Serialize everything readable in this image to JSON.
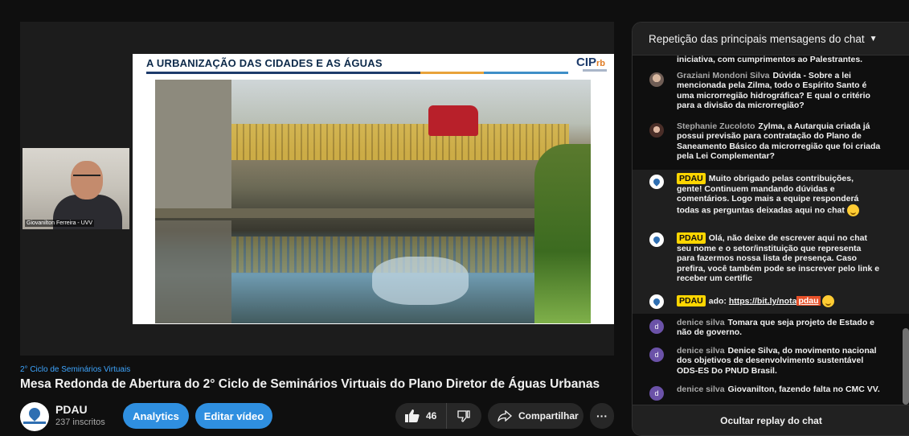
{
  "video": {
    "slide": {
      "title": "A URBANIZAÇÃO DAS CIDADES E AS ÁGUAS",
      "logo_main": "CIP",
      "logo_accent": "rb"
    },
    "camera_label": "Giovanilton Ferreira - UVV"
  },
  "meta": {
    "playlist": "2° Ciclo de Seminários Virtuais",
    "title": "Mesa Redonda de Abertura do 2° Ciclo de Seminários Virtuais do Plano Diretor de Águas Urbanas",
    "channel": "PDAU",
    "subscribers": "237 inscritos",
    "analytics_label": "Analytics",
    "edit_label": "Editar vídeo",
    "likes": "46",
    "share_label": "Compartilhar",
    "more_label": "···"
  },
  "chat": {
    "header": "Repetição das principais mensagens do chat",
    "footer": "Ocultar replay do chat",
    "messages": [
      {
        "name": "",
        "text": "iniciativa, com cumprimentos ao Palestrantes."
      },
      {
        "name": "Graziani Mondoni Silva",
        "text": "Dúvida - Sobre a lei mencionada pela Zilma, todo o Espírito Santo é uma microrregião hidrográfica? E qual o critério para a divisão da microrregião?"
      },
      {
        "name": "Stephanie Zucoloto",
        "text": "Zylma, a Autarquia criada já possui previsão para contratação do Plano de Saneamento Básico da microrregião que foi criada pela Lei Complementar?"
      },
      {
        "name": "PDAU",
        "text": "Muito obrigado pelas contribuições, gente! Continuem mandando dúvidas e comentários. Logo mais a equipe responderá todas as perguntas deixadas aqui no chat"
      },
      {
        "name": "PDAU",
        "text": "Olá, não deixe de escrever aqui no chat seu nome e o setor/instituição que representa para fazermos nossa lista de presença. Caso prefira, você também pode se inscrever pelo link e receber um certific"
      },
      {
        "name": "PDAU",
        "text_pre": "ado: ",
        "link": "https://bit.ly/nota",
        "link_hl": "pdau"
      },
      {
        "name": "denice silva",
        "text": "Tomara que seja projeto de Estado e não de governo.",
        "initial": "d"
      },
      {
        "name": "denice silva",
        "text": "Denice Silva, do movimento nacional dos objetivos de desenvolvimento sustentável ODS-ES Do PNUD Brasil.",
        "initial": "d"
      },
      {
        "name": "denice silva",
        "text": "Giovanilton, fazendo falta no CMC VV.",
        "initial": "d"
      }
    ]
  },
  "colors": {
    "accent_blue": "#3ea6ff",
    "badge_yellow": "#ffd600",
    "link_highlight": "#e8512a"
  }
}
